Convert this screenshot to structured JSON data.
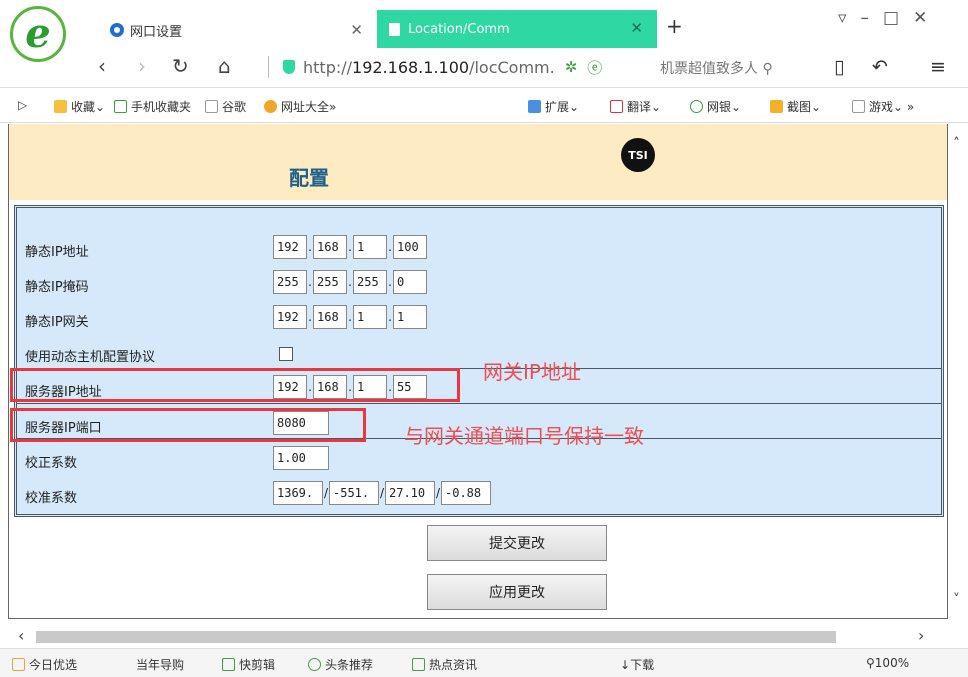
{
  "browser": {
    "tabs": [
      {
        "label": "网口设置"
      },
      {
        "label": "Location/Comm"
      }
    ],
    "address_prefix": "http://",
    "address_host": "192.168.1.100",
    "address_path": "/locComm.",
    "search_text": "机票超值致多人",
    "bookmarks": [
      "收藏",
      "手机收藏夹",
      "谷歌",
      "网址大全"
    ],
    "bookmarks_right": [
      "扩展",
      "翻译",
      "网银",
      "截图",
      "游戏"
    ]
  },
  "page": {
    "title": "配置",
    "logo_text": "TSI",
    "fields": {
      "static_ip": {
        "label": "静态IP地址",
        "values": [
          "192",
          "168",
          "1",
          "100"
        ]
      },
      "static_mask": {
        "label": "静态IP掩码",
        "values": [
          "255",
          "255",
          "255",
          "0"
        ]
      },
      "static_gateway": {
        "label": "静态IP网关",
        "values": [
          "192",
          "168",
          "1",
          "1"
        ]
      },
      "dhcp": {
        "label": "使用动态主机配置协议",
        "checked": false
      },
      "server_ip": {
        "label": "服务器IP地址",
        "values": [
          "192",
          "168",
          "1",
          "55"
        ]
      },
      "server_port": {
        "label": "服务器IP端口",
        "value": "8080"
      },
      "correction": {
        "label": "校正系数",
        "value": "1.00"
      },
      "calibration": {
        "label": "校准系数",
        "values": [
          "1369.",
          "-551.",
          "27.10",
          "-0.88"
        ]
      }
    },
    "buttons": {
      "submit": "提交更改",
      "apply": "应用更改"
    },
    "annotations": {
      "gateway": "网关IP地址",
      "port": "与网关通道端口号保持一致"
    }
  },
  "statusbar": {
    "items": [
      "今日优选",
      "当年导购",
      "快剪辑",
      "头条推荐",
      "热点资讯",
      "下载"
    ],
    "zoom": "100%"
  }
}
